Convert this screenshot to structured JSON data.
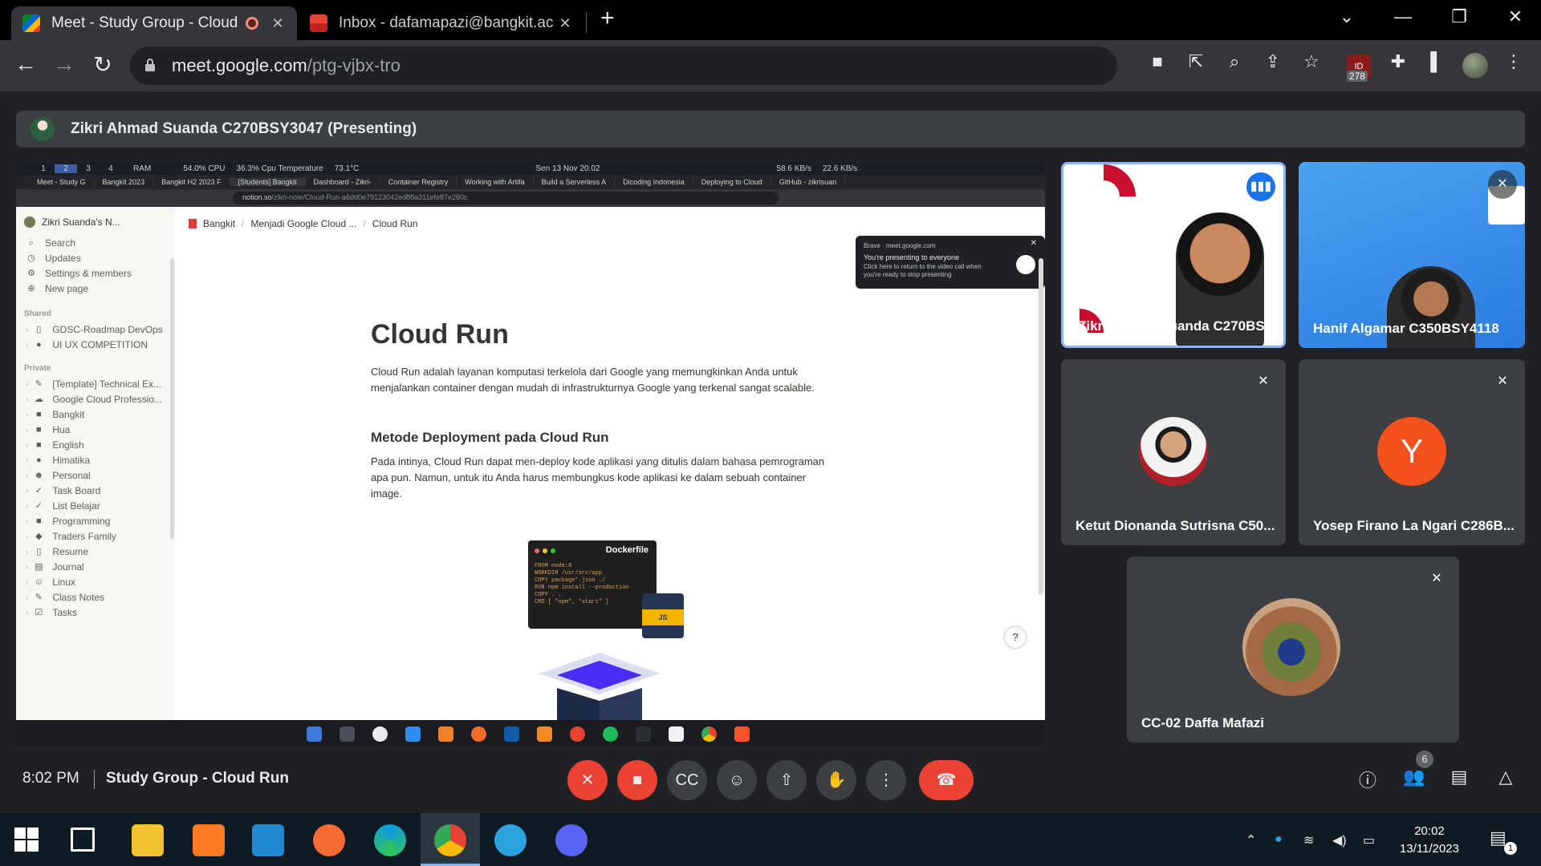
{
  "browser": {
    "tabs": [
      {
        "title": "Meet - Study Group - Cloud",
        "recording": true
      },
      {
        "title": "Inbox - dafamapazi@bangkit.ac"
      }
    ],
    "url_host": "meet.google.com",
    "url_path": "/ptg-vjbx-tro",
    "extension_badge": "278"
  },
  "meet": {
    "presenter_banner": "Zikri Ahmad Suanda C270BSY3047 (Presenting)",
    "clock": "8:02 PM",
    "meeting_name": "Study Group - Cloud Run",
    "people_count": "6",
    "tiles": [
      {
        "name": "Zikri Ahmad Suanda C270BS..."
      },
      {
        "name": "Hanif Algamar C350BSY4118"
      },
      {
        "name": "Ketut Dionanda Sutrisna C50..."
      },
      {
        "name": "Yosep Firano La Ngari C286B...",
        "initial": "Y"
      },
      {
        "name": "CC-02 Daffa Mafazi"
      }
    ]
  },
  "shared_screen": {
    "status_bar": {
      "workspaces": [
        "1",
        "2",
        "3",
        "4"
      ],
      "ram": "RAM",
      "cpu": "54.0% CPU",
      "temp": "36.3% Cpu Temperature",
      "temp_val": "73.1°C",
      "datetime": "Sen 13 Nov  20.02",
      "net_down": "58.6 KB/s",
      "net_up": "22.6 KB/s"
    },
    "browser_tabs": [
      "Meet - Study G",
      "Bangkit 2023",
      "Bangkit H2 2023 F",
      "[Students] Bangkit",
      "Dashboard - Zikri-",
      "Container Registry",
      "Working with Artifa",
      "Build a Serverless A",
      "Dicoding Indonesia",
      "Deploying to Cloud",
      "GitHub - zikrisuan"
    ],
    "url_host": "notion.so",
    "url_path": "/zikri-note/Cloud-Run-a6dd0e79123042ed88a311efe87e260c",
    "popup": {
      "source": "Brave · meet.google.com",
      "title": "You're presenting to everyone",
      "body": "Click here to return to the video call when you're ready to stop presenting"
    },
    "notion": {
      "workspace": "Zikri Suanda's N...",
      "nav": [
        "Search",
        "Updates",
        "Settings & members",
        "New page"
      ],
      "shared_label": "Shared",
      "shared": [
        "GDSC-Roadmap DevOps",
        "UI UX COMPETITION"
      ],
      "private_label": "Private",
      "private": [
        "[Template] Technical Ex...",
        "Google Cloud Professio...",
        "Bangkit",
        "Hua",
        "English",
        "Himatika",
        "Personal",
        "Task Board",
        "List Belajar",
        "Programming",
        "Traders Family",
        "Resume",
        "Journal",
        "Linux",
        "Class Notes",
        "Tasks"
      ],
      "breadcrumb": [
        "Bangkit",
        "Menjadi Google Cloud ...",
        "Cloud Run"
      ],
      "title": "Cloud Run",
      "intro": "Cloud Run adalah layanan komputasi terkelola dari Google yang memungkinkan Anda untuk menjalankan container dengan mudah di infrastrukturnya Google yang terkenal sangat scalable.",
      "heading": "Metode Deployment pada Cloud Run",
      "body": "Pada intinya, Cloud Run dapat men-deploy kode aplikasi yang ditulis dalam bahasa pemrograman apa pun. Namun, untuk itu Anda harus membungkus kode aplikasi ke dalam sebuah container image.",
      "image_label": "Dockerfile",
      "help": "?"
    }
  },
  "taskbar": {
    "time": "20:02",
    "date": "13/11/2023",
    "notif_count": "1"
  },
  "colors": {
    "meet_bg": "#202124",
    "tile_bg": "#3c4043",
    "end_call": "#ea4335",
    "active_speaker": "#8ab4f8"
  }
}
